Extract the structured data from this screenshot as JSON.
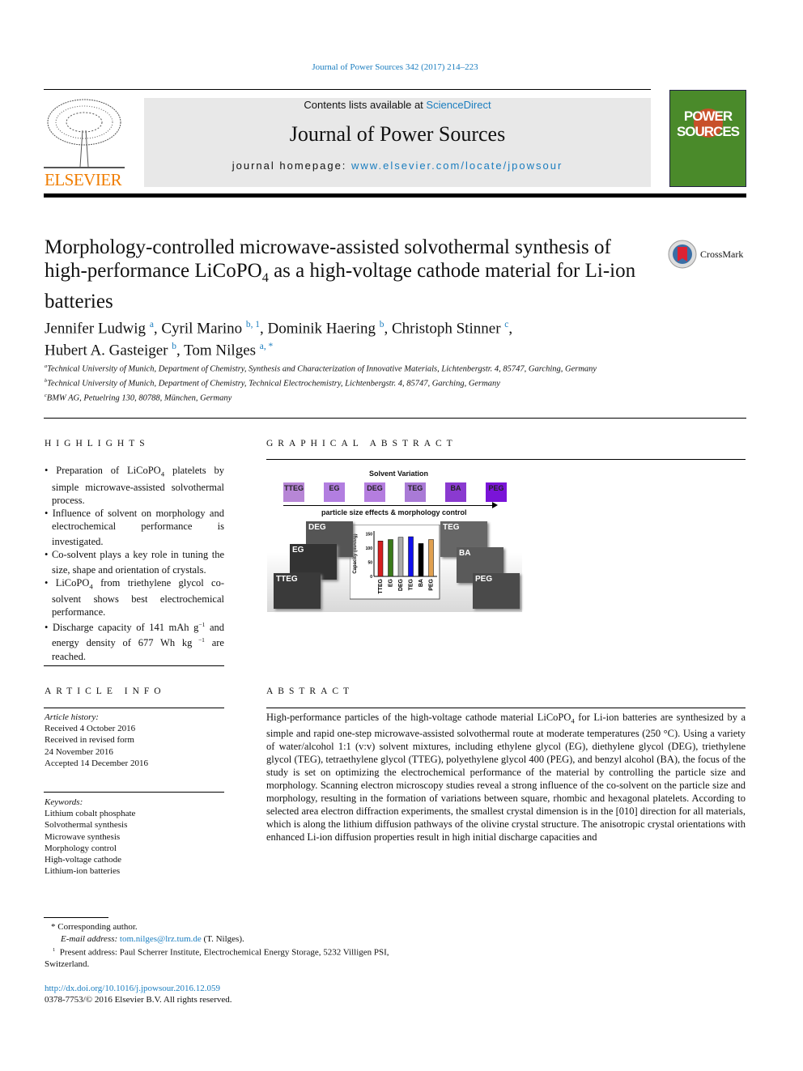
{
  "header": {
    "journal_ref": "Journal of Power Sources 342 (2017) 214–223",
    "contents_prefix": "Contents lists available at ",
    "sciencedirect": "ScienceDirect",
    "journal_title": "Journal of Power Sources",
    "homepage_prefix": "journal homepage: ",
    "homepage_url": "www.elsevier.com/locate/jpowsour",
    "publisher": "ELSEVIER",
    "cover_text": "POWER SOURCES"
  },
  "crossmark": "CrossMark",
  "title_parts": [
    "Morphology-controlled microwave-assisted solvothermal synthesis of high-performance LiCoPO",
    "4",
    " as a high-voltage cathode material for Li-ion batteries"
  ],
  "authors": [
    {
      "name": "Jennifer Ludwig",
      "sup": "a"
    },
    {
      "name": "Cyril Marino",
      "sup": "b, 1"
    },
    {
      "name": "Dominik Haering",
      "sup": "b"
    },
    {
      "name": "Christoph Stinner",
      "sup": "c"
    },
    {
      "name": "Hubert A. Gasteiger",
      "sup": "b"
    },
    {
      "name": "Tom Nilges",
      "sup": "a, *"
    }
  ],
  "affiliations": [
    {
      "sup": "a",
      "text": "Technical University of Munich, Department of Chemistry, Synthesis and Characterization of Innovative Materials, Lichtenbergstr. 4, 85747, Garching, Germany"
    },
    {
      "sup": "b",
      "text": "Technical University of Munich, Department of Chemistry, Technical Electrochemistry, Lichtenbergstr. 4, 85747, Garching, Germany"
    },
    {
      "sup": "c",
      "text": "BMW AG, Petuelring 130, 80788, München, Germany"
    }
  ],
  "highlights": {
    "heading": "HIGHLIGHTS",
    "items": [
      [
        "Preparation of LiCoPO",
        "4",
        " platelets by simple microwave-assisted sol­vothermal process."
      ],
      [
        "Influence of solvent on morphology and electrochemical performance is investigated.",
        "",
        ""
      ],
      [
        "Co-solvent plays a key role in tuning the size, shape and orientation of crystals.",
        "",
        ""
      ],
      [
        "LiCoPO",
        "4",
        " from triethylene glycol co-solvent shows best electrochemical performance."
      ],
      [
        "Discharge capacity of 141 mAh g",
        "−1",
        " and energy density of 677 Wh kg",
        " −1",
        " are reached."
      ]
    ]
  },
  "graphical_abstract": {
    "heading": "GRAPHICAL ABSTRACT",
    "top_label": "Solvent Variation",
    "arrow_label": "particle size effects & morphology control",
    "solvents": [
      {
        "name": "TTEG",
        "color": "#b786d6"
      },
      {
        "name": "EG",
        "color": "#b27ee0"
      },
      {
        "name": "DEG",
        "color": "#b47ddf"
      },
      {
        "name": "TEG",
        "color": "#a97ad6"
      },
      {
        "name": "BA",
        "color": "#8a3ad0"
      },
      {
        "name": "PEG",
        "color": "#7a14d8"
      }
    ],
    "sem_labels": [
      "DEG",
      "EG",
      "TTEG",
      "TEG",
      "BA",
      "PEG"
    ],
    "chart_data": {
      "type": "bar",
      "ylabel": "Capacity (mAh/g)",
      "categories": [
        "TTEG",
        "EG",
        "DEG",
        "TEG",
        "BA",
        "PEG"
      ],
      "values": [
        125,
        130,
        138,
        140,
        116,
        130
      ],
      "colors": [
        "#d42020",
        "#3a7a1a",
        "#aaaaaa",
        "#1010ee",
        "#000000",
        "#e0a050"
      ],
      "ylim": [
        0,
        160
      ],
      "yticks": [
        0,
        50,
        100,
        150
      ]
    }
  },
  "article_info": {
    "heading": "ARTICLE INFO",
    "history_label": "Article history:",
    "history": [
      "Received 4 October 2016",
      "Received in revised form",
      "24 November 2016",
      "Accepted 14 December 2016"
    ],
    "keywords_label": "Keywords:",
    "keywords": [
      "Lithium cobalt phosphate",
      "Solvothermal synthesis",
      "Microwave synthesis",
      "Morphology control",
      "High-voltage cathode",
      "Lithium-ion batteries"
    ]
  },
  "abstract": {
    "heading": "ABSTRACT",
    "parts": [
      "High-performance particles of the high-voltage cathode material LiCoPO",
      "4",
      " for Li-ion batteries are syn­thesized by a simple and rapid one-step microwave-assisted solvothermal route at moderate tempera­tures (250 °C). Using a variety of water/alcohol 1:1 (v:v) solvent mixtures, including ethylene glycol (EG), diethylene glycol (DEG), triethylene glycol (TEG), tetraethylene glycol (TTEG), polyethylene glycol 400 (PEG), and benzyl alcohol (BA), the focus of the study is set on optimizing the electrochemical perfor­mance of the material by controlling the particle size and morphology. Scanning electron microscopy studies reveal a strong influence of the co-solvent on the particle size and morphology, resulting in the formation of variations between square, rhombic and hexagonal platelets. According to selected area electron diffraction experiments, the smallest crystal dimension is in the [010] direction for all materials, which is along the lithium diffusion pathways of the olivine crystal structure. The anisotropic crystal orientations with enhanced Li-ion diffusion properties result in high initial discharge capacities and"
    ]
  },
  "footnotes": {
    "corresponding": "Corresponding author.",
    "email_label": "E-mail address: ",
    "email": "tom.nilges@lrz.tum.de",
    "email_suffix": " (T. Nilges).",
    "present": "Present address: Paul Scherrer Institute, Electrochemical Energy Storage, 5232 Villigen PSI, Switzerland.",
    "doi": "http://dx.doi.org/10.1016/j.jpowsour.2016.12.059",
    "copyright": "0378-7753/© 2016 Elsevier B.V. All rights reserved."
  }
}
